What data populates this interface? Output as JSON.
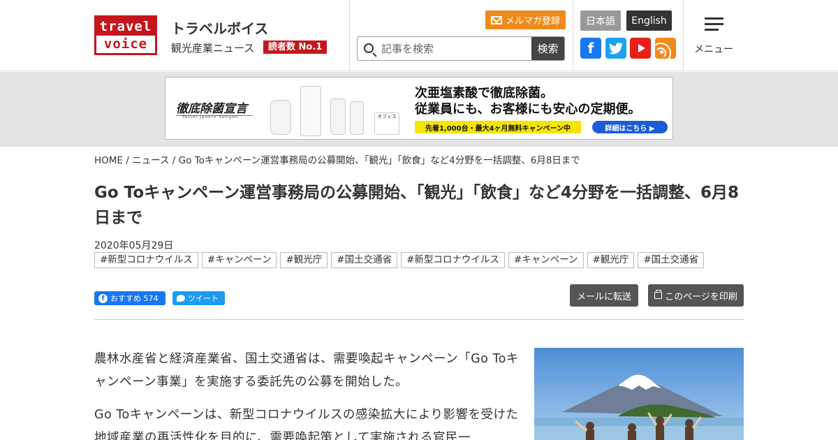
{
  "header": {
    "logo_top": "travel",
    "logo_bottom": "voice",
    "site_name": "トラベルボイス",
    "tagline": "観光産業ニュース",
    "badge": "読者数 No.1",
    "newsletter_label": "メルマガ登録",
    "search_placeholder": "記事を検索",
    "search_button": "検索",
    "lang_jp": "日本語",
    "lang_en": "English",
    "menu_label": "メニュー",
    "social": [
      {
        "name": "facebook",
        "glyph": "f",
        "color": "#1877f2"
      },
      {
        "name": "twitter",
        "glyph": "",
        "color": "#1da1f2"
      },
      {
        "name": "youtube",
        "glyph": "",
        "color": "#e62117"
      },
      {
        "name": "rss",
        "glyph": "",
        "color": "#f08a1c"
      }
    ]
  },
  "ad": {
    "brand": "徹底除菌宣言",
    "brand_sub": "Tettei Jyokin Sengen",
    "product_label": "オフィス",
    "headline1": "次亜塩素酸で徹底除菌。",
    "headline2": "従業員にも、お客様にも安心の定期便。",
    "cta1": "先着1,000台・最大4ヶ月無料キャンペーン中",
    "cta2": "詳細はこちら ▶"
  },
  "breadcrumb": {
    "home": "HOME",
    "sep1": "/",
    "news": "ニュース",
    "sep2": "/",
    "current": "Go Toキャンペーン運営事務局の公募開始、「観光」「飲食」など4分野を一括調整、6月8日まで"
  },
  "article": {
    "title": "Go Toキャンペーン運営事務局の公募開始、「観光」「飲食」など4分野を一括調整、6月8日まで",
    "date": "2020年05月29日",
    "tags": [
      "#新型コロナウイルス",
      "#キャンペーン",
      "#観光庁",
      "#国土交通省",
      "#新型コロナウイルス",
      "#キャンペーン",
      "#観光庁",
      "#国土交通省"
    ],
    "fb_label": "おすすめ 574",
    "tw_label": "ツイート",
    "mail_button": "メールに転送",
    "print_button": "このページを印刷",
    "paragraphs": [
      "農林水産省と経済産業省、国土交通省は、需要喚起キャンペーン「Go Toキャンペーン事業」を実施する委託先の公募を開始した。",
      "Go Toキャンペーンは、新型コロナウイルスの感染拡大により影響を受けた地域産業の再活性化を目的に、需要喚起策として実施される官民一"
    ]
  },
  "colors": {
    "brand_red": "#c4161c",
    "orange": "#f08a1c",
    "dark_button": "#555555"
  }
}
